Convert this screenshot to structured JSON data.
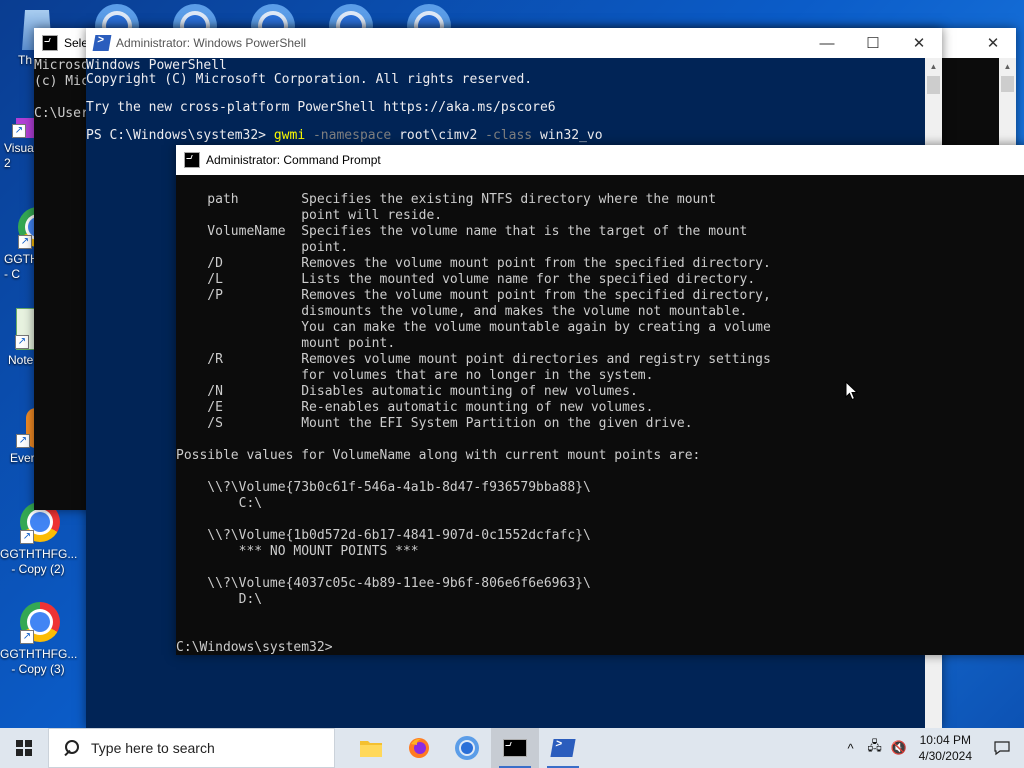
{
  "desktop": {
    "icons": [
      {
        "label": "Th",
        "name": "recycle-bin"
      },
      {
        "label": "Visua\n2",
        "name": "visual-studio-shortcut"
      },
      {
        "label": "GGTH\n- C",
        "name": "chrome-shortcut"
      },
      {
        "label": "Note",
        "name": "notepad-shortcut"
      },
      {
        "label": "Ever",
        "name": "everything-shortcut"
      },
      {
        "label": "GGTHTHFG...\n- Copy (2)",
        "name": "chrome-copy-2"
      },
      {
        "label": "GGTHTHFG...\n- Copy (3)",
        "name": "chrome-copy-3"
      }
    ]
  },
  "back_window": {
    "title": "Sele",
    "lines": "Microso\n(c) Mic\n\nC:\\User"
  },
  "powershell": {
    "title": "Administrator: Windows PowerShell",
    "line1": "Windows PowerShell",
    "line2": "Copyright (C) Microsoft Corporation. All rights reserved.",
    "line3": "Try the new cross-platform PowerShell https://aka.ms/pscore6",
    "prompt": "PS C:\\Windows\\system32> ",
    "cmd": "gwmi",
    "param1": " -namespace",
    "arg1": " root\\cimv2",
    "param2": " -class",
    "arg2": " win32_vo"
  },
  "cmd": {
    "title": "Administrator: Command Prompt",
    "output": "    path        Specifies the existing NTFS directory where the mount\n                point will reside.\n    VolumeName  Specifies the volume name that is the target of the mount\n                point.\n    /D          Removes the volume mount point from the specified directory.\n    /L          Lists the mounted volume name for the specified directory.\n    /P          Removes the volume mount point from the specified directory,\n                dismounts the volume, and makes the volume not mountable.\n                You can make the volume mountable again by creating a volume\n                mount point.\n    /R          Removes volume mount point directories and registry settings\n                for volumes that are no longer in the system.\n    /N          Disables automatic mounting of new volumes.\n    /E          Re-enables automatic mounting of new volumes.\n    /S          Mount the EFI System Partition on the given drive.\n\nPossible values for VolumeName along with current mount points are:\n\n    \\\\?\\Volume{73b0c61f-546a-4a1b-8d47-f936579bba88}\\\n        C:\\\n\n    \\\\?\\Volume{1b0d572d-6b17-4841-907d-0c1552dcfafc}\\\n        *** NO MOUNT POINTS ***\n\n    \\\\?\\Volume{4037c05c-4b89-11ee-9b6f-806e6f6e6963}\\\n        D:\\\n\n\nC:\\Windows\\system32>"
  },
  "taskbar": {
    "search_placeholder": "Type here to search",
    "time": "10:04 PM",
    "date": "4/30/2024"
  },
  "colors": {
    "ps_background": "#012456",
    "cmd_background": "#0c0c0c",
    "ps_cmd_yellow": "#ffff00",
    "ps_param_gray": "#808080"
  }
}
